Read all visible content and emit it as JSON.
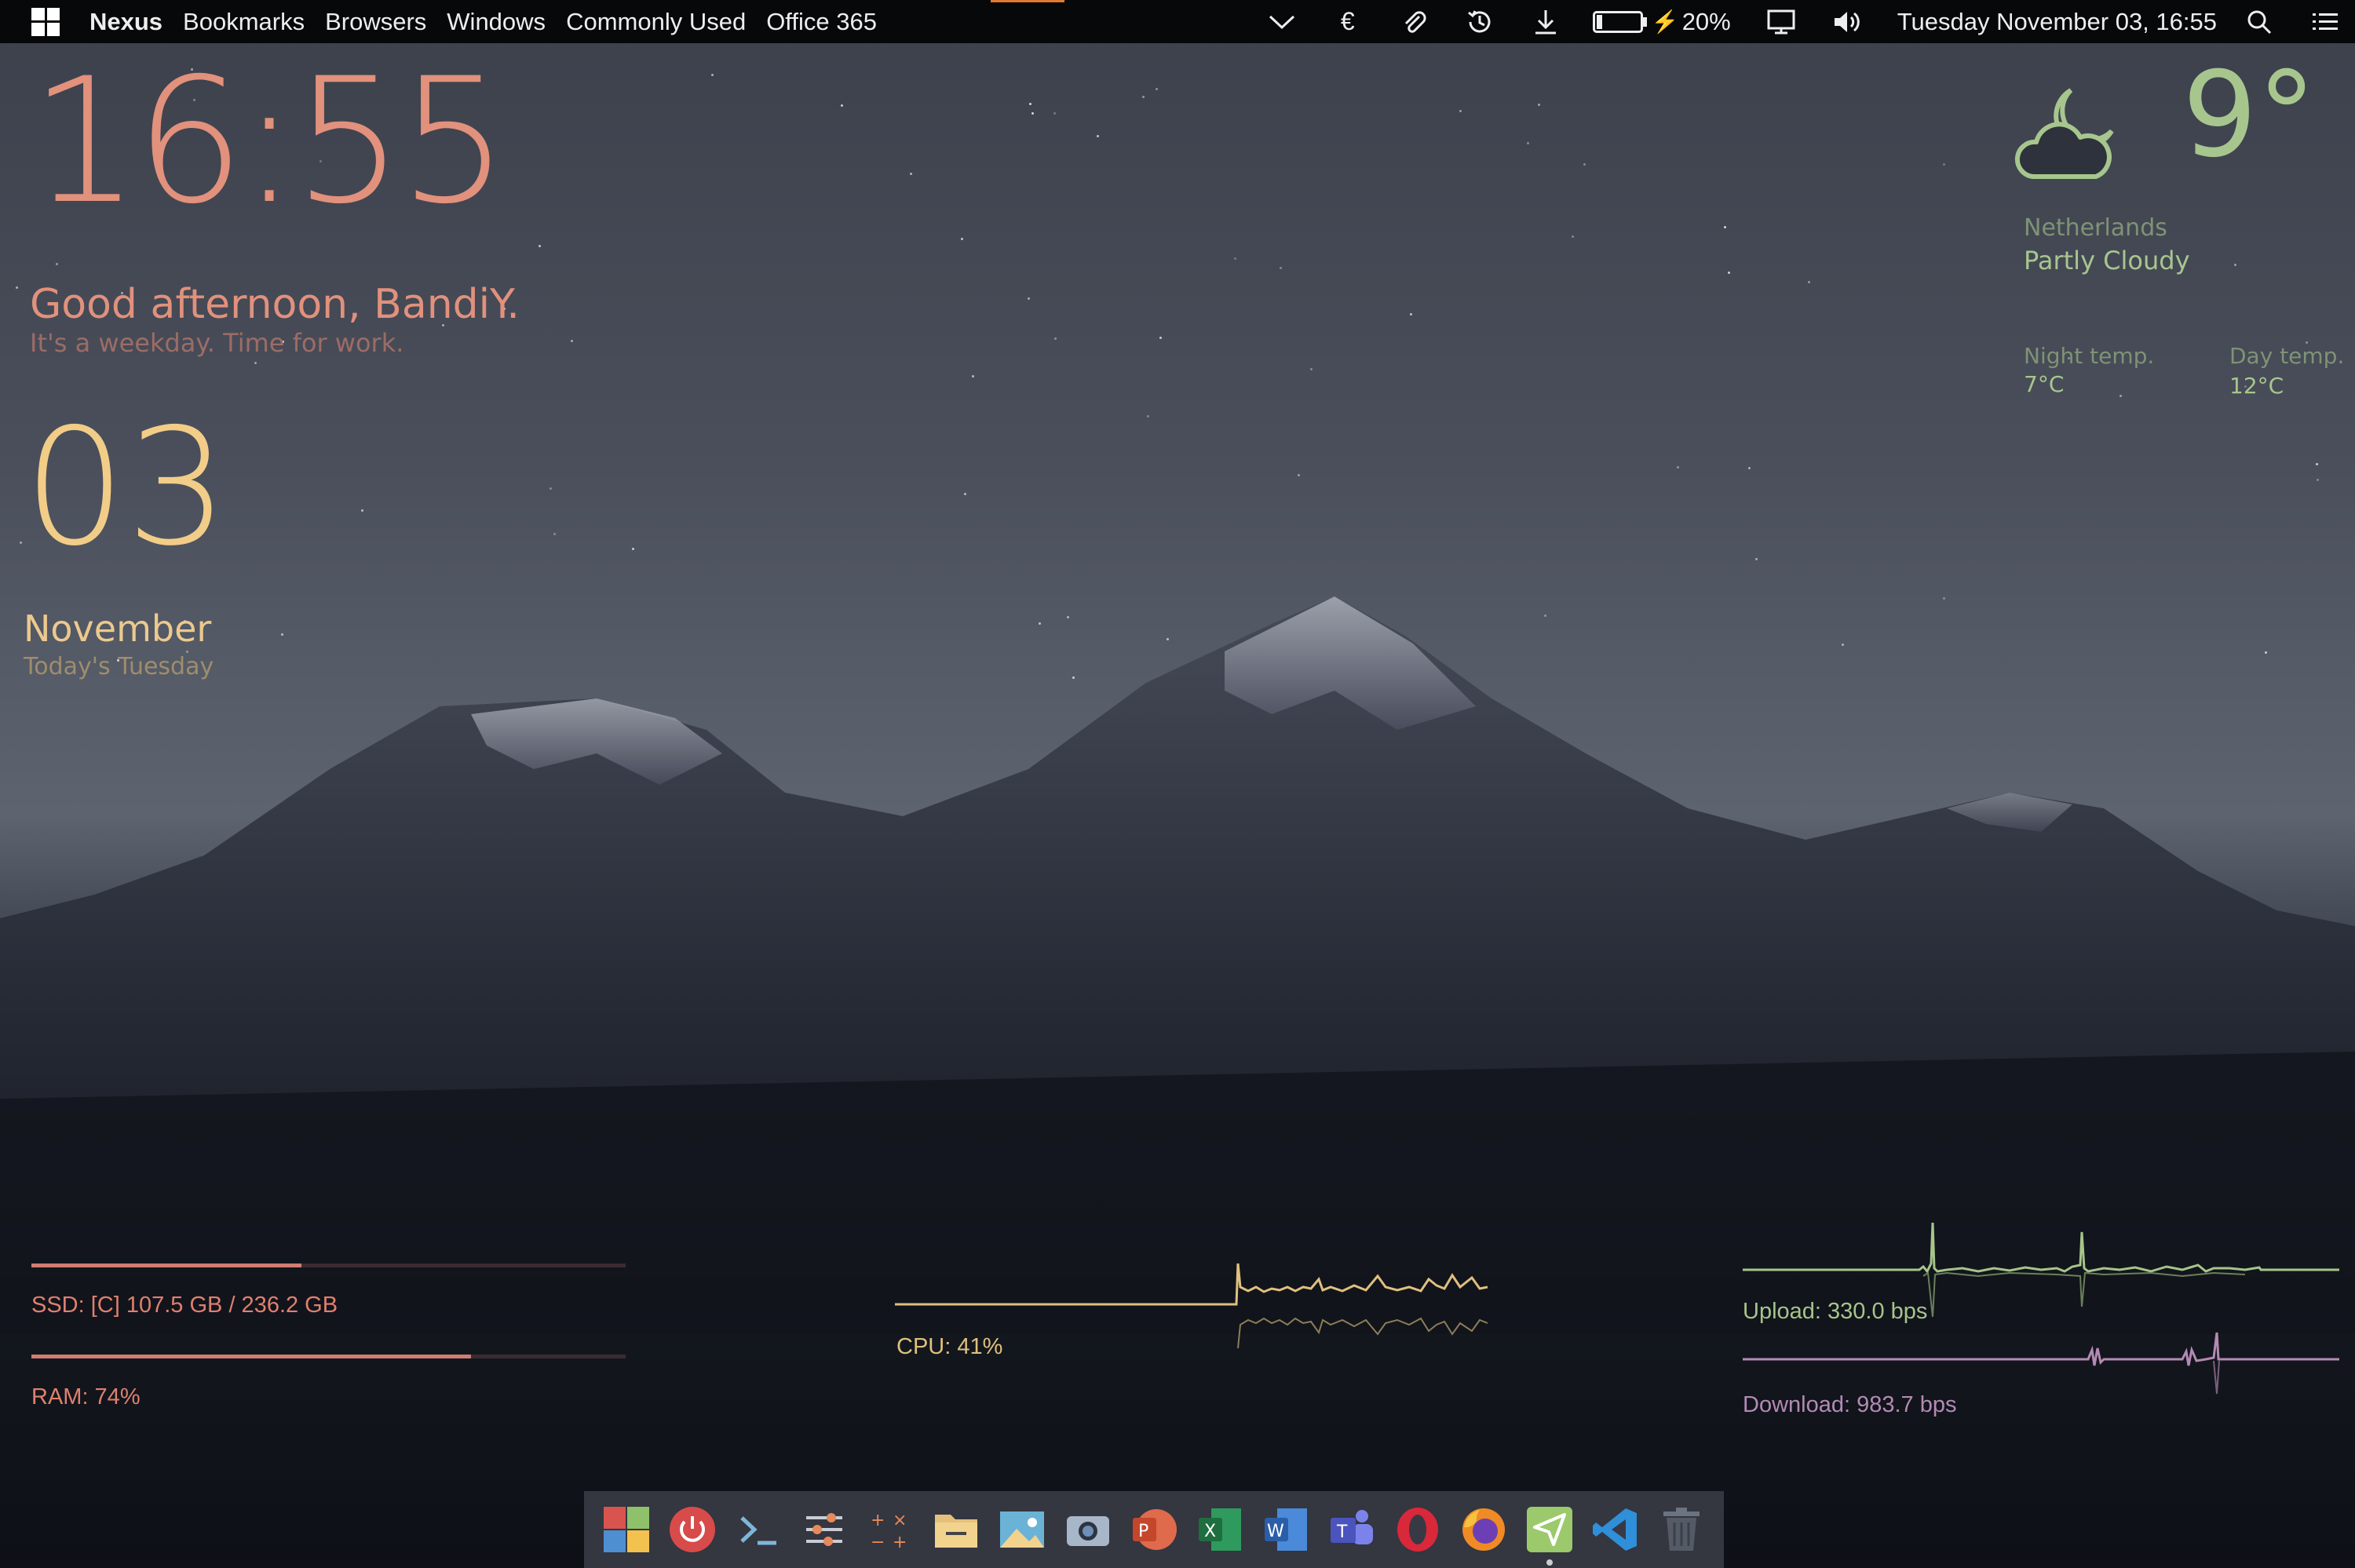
{
  "menubar": {
    "items": [
      "Nexus",
      "Bookmarks",
      "Browsers",
      "Windows",
      "Commonly Used",
      "Office 365"
    ],
    "battery_percent": "20%",
    "battery_level": 0.2,
    "datetime": "Tuesday November 03, 16:55",
    "tray_icons": [
      "chevron-down-icon",
      "euro-icon",
      "paperclip-icon",
      "history-icon",
      "download-icon",
      "battery-icon",
      "display-icon",
      "volume-icon",
      "search-icon",
      "list-icon"
    ]
  },
  "clock": {
    "time": "16:55"
  },
  "greeting": {
    "title": "Good afternoon, BandiY.",
    "subtitle": "It's a weekday. Time for work."
  },
  "date": {
    "day": "03",
    "month": "November",
    "subtitle": "Today's Tuesday"
  },
  "weather": {
    "temperature": "9°",
    "country": "Netherlands",
    "condition": "Partly Cloudy",
    "night_label": "Night temp.",
    "night_value": "7°C",
    "day_label": "Day temp.",
    "day_value": "12°C"
  },
  "system": {
    "ssd_label": "SSD: [C] 107.5 GB / 236.2 GB",
    "ssd_level": 0.455,
    "ram_label": "RAM: 74%",
    "ram_level": 0.74,
    "cpu_label": "CPU: 41%",
    "upload_label": "Upload: 330.0 bps",
    "download_label": "Download: 983.7 bps"
  },
  "colors": {
    "clock": "#e1917c",
    "date": "#f1cd88",
    "weather": "#a7c68e",
    "cpu": "#dfc07e",
    "download": "#b48ab4"
  },
  "dock": {
    "apps": [
      "windows-tiles-icon",
      "power-icon",
      "terminal-icon",
      "settings-sliders-icon",
      "calculator-icon",
      "files-icon",
      "photos-icon",
      "camera-icon",
      "powerpoint-icon",
      "excel-icon",
      "word-icon",
      "teams-icon",
      "opera-icon",
      "firefox-icon",
      "send-icon",
      "vscode-icon",
      "trash-icon"
    ]
  }
}
